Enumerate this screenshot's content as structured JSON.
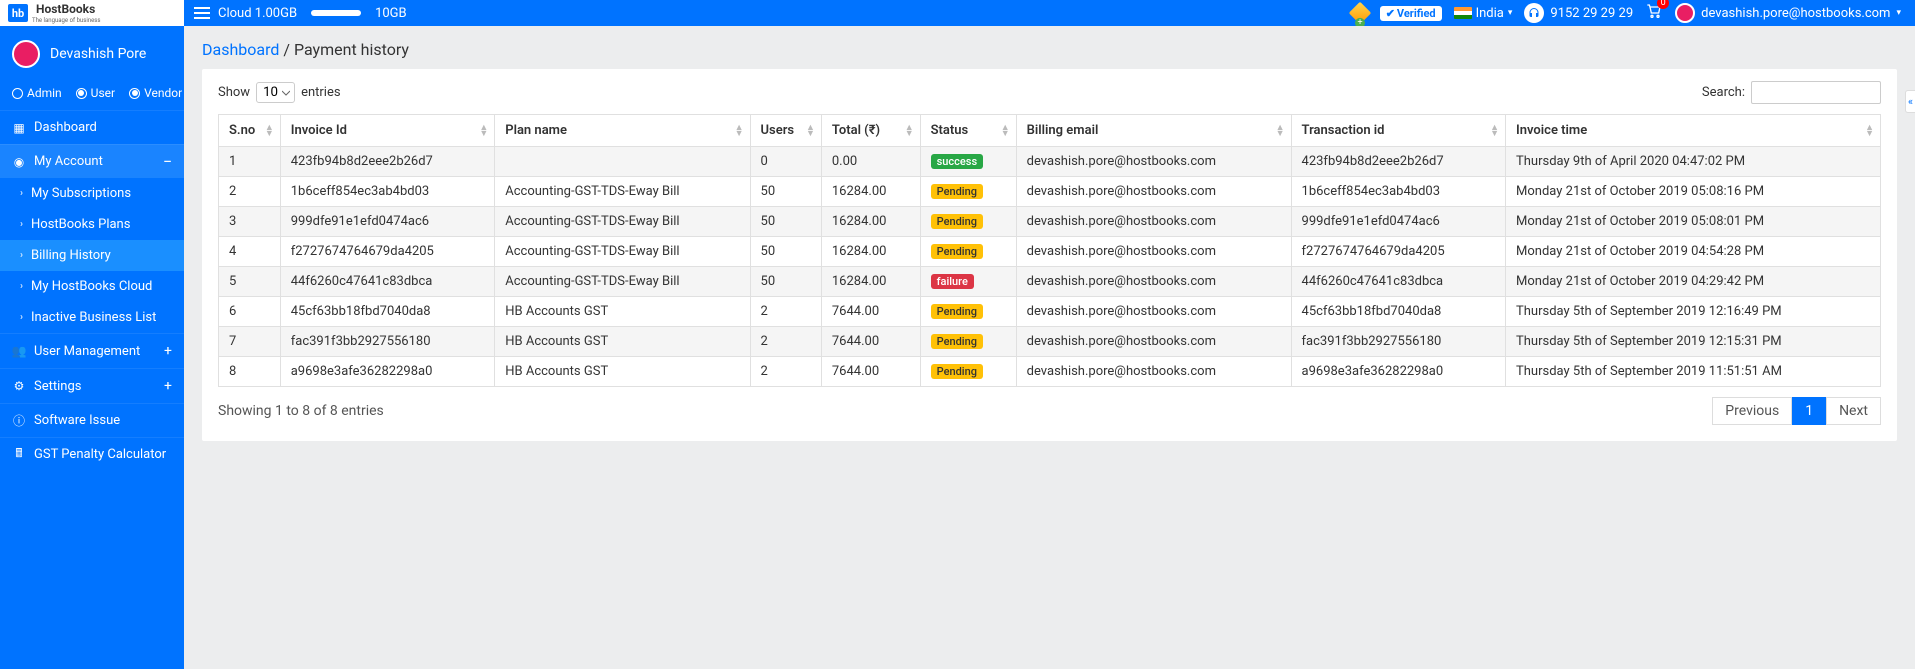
{
  "header": {
    "logo_main": "HostBooks",
    "logo_sub": "The language of business",
    "cloud_used": "Cloud 1.00GB",
    "cloud_total": "10GB",
    "verified_badge": "Verified",
    "country": "India",
    "phone": "9152 29 29 29",
    "cart_count": "0",
    "user_email": "devashish.pore@hostbooks.com"
  },
  "sidebar": {
    "user_name": "Devashish Pore",
    "roles": {
      "admin": "Admin",
      "user": "User",
      "vendor": "Vendor"
    },
    "items": {
      "dashboard": "Dashboard",
      "my_account": "My Account",
      "my_subscriptions": "My Subscriptions",
      "hostbooks_plans": "HostBooks Plans",
      "billing_history": "Billing History",
      "my_hostbooks_cloud": "My HostBooks Cloud",
      "inactive_business": "Inactive Business List",
      "user_management": "User Management",
      "settings": "Settings",
      "software_issue": "Software Issue",
      "gst_penalty": "GST Penalty Calculator"
    }
  },
  "breadcrumb": {
    "root": "Dashboard",
    "sep": " / ",
    "current": "Payment history"
  },
  "table": {
    "show_label": "Show",
    "entries_label": "entries",
    "page_size": "10",
    "search_label": "Search:",
    "columns": [
      "S.no",
      "Invoice Id",
      "Plan name",
      "Users",
      "Total (₹)",
      "Status",
      "Billing email",
      "Transaction id",
      "Invoice time"
    ],
    "rows": [
      {
        "sno": "1",
        "invoice": "423fb94b8d2eee2b26d7",
        "plan": "",
        "users": "0",
        "total": "0.00",
        "status": "success",
        "email": "devashish.pore@hostbooks.com",
        "txn": "423fb94b8d2eee2b26d7",
        "time": "Thursday 9th of April 2020 04:47:02 PM"
      },
      {
        "sno": "2",
        "invoice": "1b6ceff854ec3ab4bd03",
        "plan": "Accounting-GST-TDS-Eway Bill",
        "users": "50",
        "total": "16284.00",
        "status": "pending",
        "email": "devashish.pore@hostbooks.com",
        "txn": "1b6ceff854ec3ab4bd03",
        "time": "Monday 21st of October 2019 05:08:16 PM"
      },
      {
        "sno": "3",
        "invoice": "999dfe91e1efd0474ac6",
        "plan": "Accounting-GST-TDS-Eway Bill",
        "users": "50",
        "total": "16284.00",
        "status": "pending",
        "email": "devashish.pore@hostbooks.com",
        "txn": "999dfe91e1efd0474ac6",
        "time": "Monday 21st of October 2019 05:08:01 PM"
      },
      {
        "sno": "4",
        "invoice": "f2727674764679da4205",
        "plan": "Accounting-GST-TDS-Eway Bill",
        "users": "50",
        "total": "16284.00",
        "status": "pending",
        "email": "devashish.pore@hostbooks.com",
        "txn": "f2727674764679da4205",
        "time": "Monday 21st of October 2019 04:54:28 PM"
      },
      {
        "sno": "5",
        "invoice": "44f6260c47641c83dbca",
        "plan": "Accounting-GST-TDS-Eway Bill",
        "users": "50",
        "total": "16284.00",
        "status": "failure",
        "email": "devashish.pore@hostbooks.com",
        "txn": "44f6260c47641c83dbca",
        "time": "Monday 21st of October 2019 04:29:42 PM"
      },
      {
        "sno": "6",
        "invoice": "45cf63bb18fbd7040da8",
        "plan": "HB Accounts GST",
        "users": "2",
        "total": "7644.00",
        "status": "pending",
        "email": "devashish.pore@hostbooks.com",
        "txn": "45cf63bb18fbd7040da8",
        "time": "Thursday 5th of September 2019 12:16:49 PM"
      },
      {
        "sno": "7",
        "invoice": "fac391f3bb2927556180",
        "plan": "HB Accounts GST",
        "users": "2",
        "total": "7644.00",
        "status": "pending",
        "email": "devashish.pore@hostbooks.com",
        "txn": "fac391f3bb2927556180",
        "time": "Thursday 5th of September 2019 12:15:31 PM"
      },
      {
        "sno": "8",
        "invoice": "a9698e3afe36282298a0",
        "plan": "HB Accounts GST",
        "users": "2",
        "total": "7644.00",
        "status": "pending",
        "email": "devashish.pore@hostbooks.com",
        "txn": "a9698e3afe36282298a0",
        "time": "Thursday 5th of September 2019 11:51:51 AM"
      }
    ],
    "status_labels": {
      "success": "success",
      "pending": "Pending",
      "failure": "failure"
    },
    "info": "Showing 1 to 8 of 8 entries",
    "pager": {
      "prev": "Previous",
      "page": "1",
      "next": "Next"
    }
  }
}
